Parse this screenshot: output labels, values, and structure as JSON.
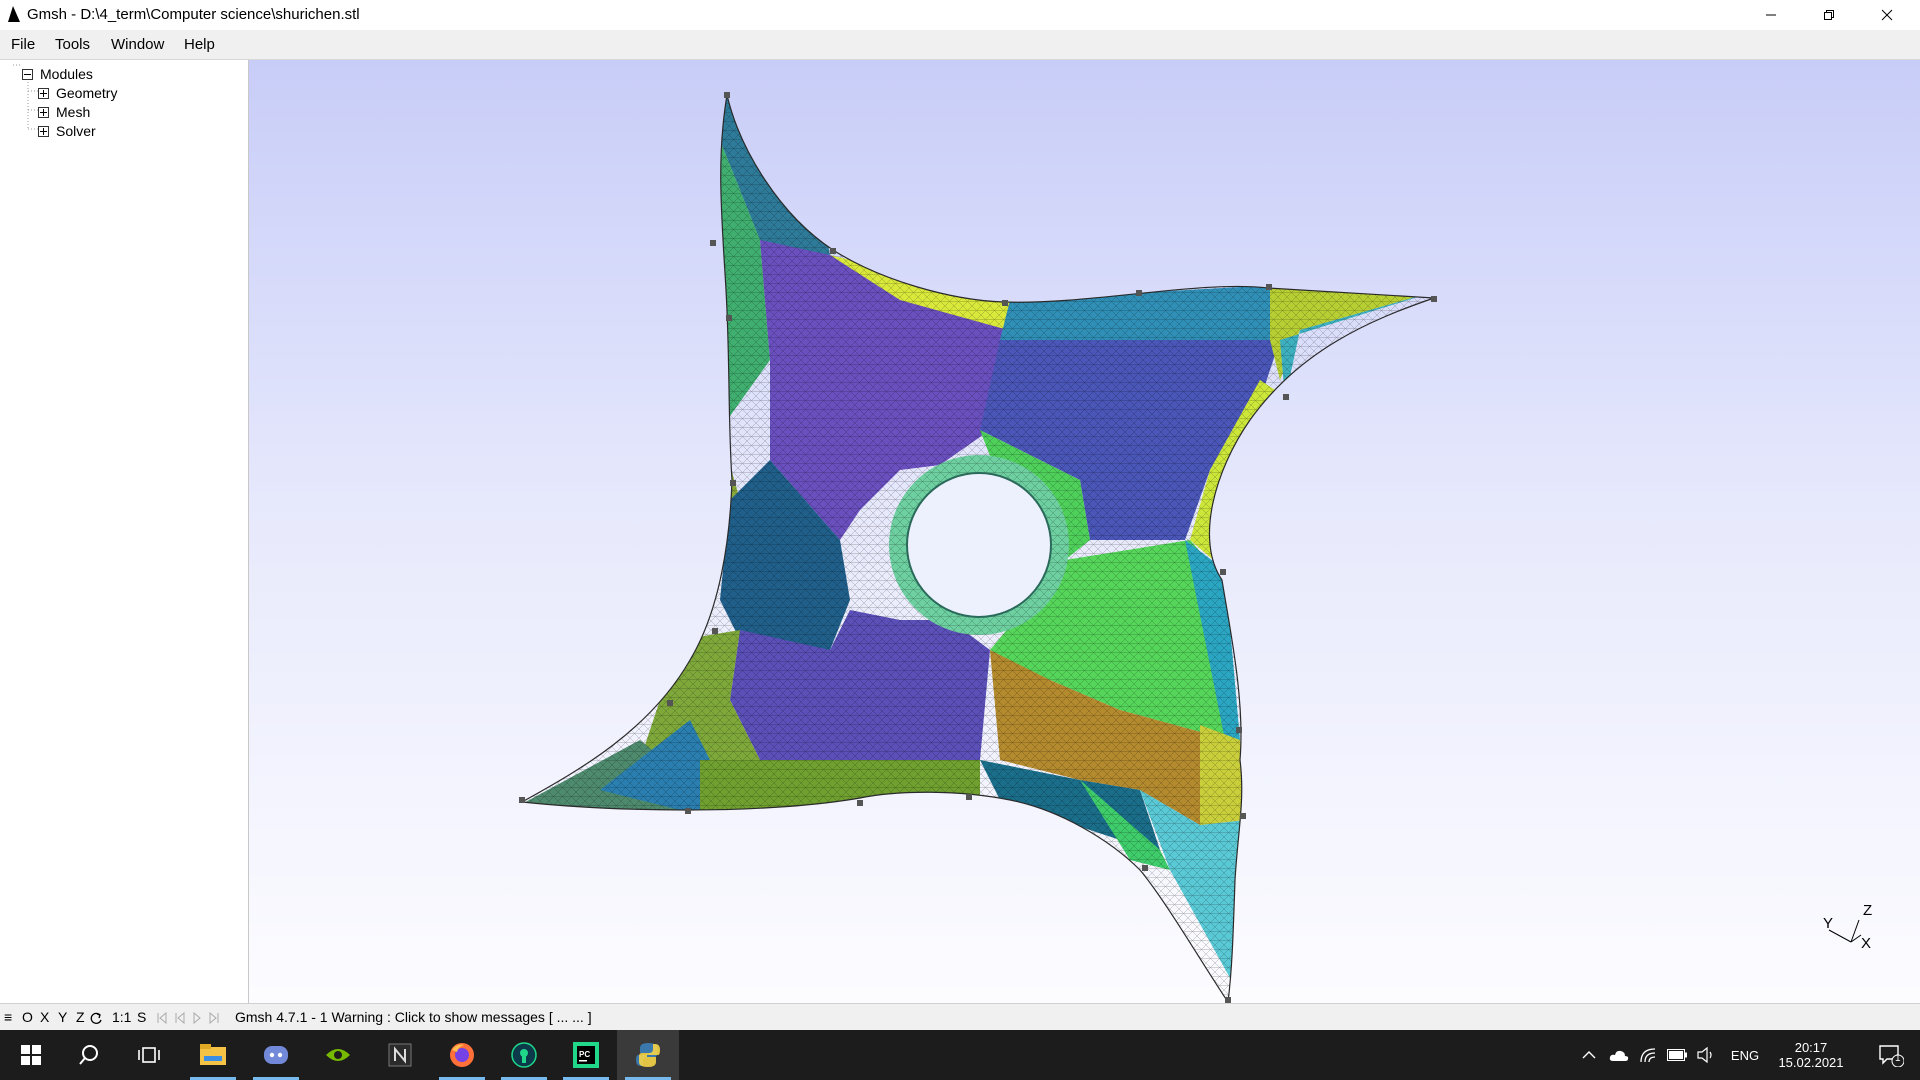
{
  "window": {
    "title": "Gmsh - D:\\4_term\\Computer science\\shurichen.stl",
    "controls": [
      "minimize-icon",
      "restore-icon",
      "close-icon"
    ]
  },
  "menu": {
    "items": [
      "File",
      "Tools",
      "Window",
      "Help"
    ]
  },
  "tree": {
    "root": "Modules",
    "children": [
      "Geometry",
      "Mesh",
      "Solver"
    ]
  },
  "graphics": {
    "axes": {
      "x": "X",
      "y": "Y",
      "z": "Z"
    },
    "colors": [
      "#2e7a99",
      "#5ac9d6",
      "#3db0c0",
      "#d9e83a",
      "#b8cf33",
      "#55d65a",
      "#3fcc6a",
      "#6a4fbf",
      "#5b4fb8",
      "#4a63b5",
      "#7ea83a",
      "#b48a2e",
      "#1a6e8a"
    ]
  },
  "statusbar": {
    "menu_icon": "≡",
    "view_buttons": [
      "O",
      "X",
      "Y",
      "Z"
    ],
    "rotate_icon": "rotate-icon",
    "scale": "1:1",
    "s_label": "S",
    "message": "Gmsh 4.7.1  -  1 Warning : Click to show messages [ ...   ... ]"
  },
  "taskbar": {
    "apps": [
      "start-icon",
      "search-icon",
      "task-view-icon",
      "file-explorer-icon",
      "discord-icon",
      "nvidia-icon",
      "notion-icon",
      "firefox-icon",
      "pycharm-ce-icon",
      "pycharm-icon",
      "python-icon"
    ],
    "language": "ENG",
    "time": "20:17",
    "date": "15.02.2021",
    "notification_count": "1"
  }
}
